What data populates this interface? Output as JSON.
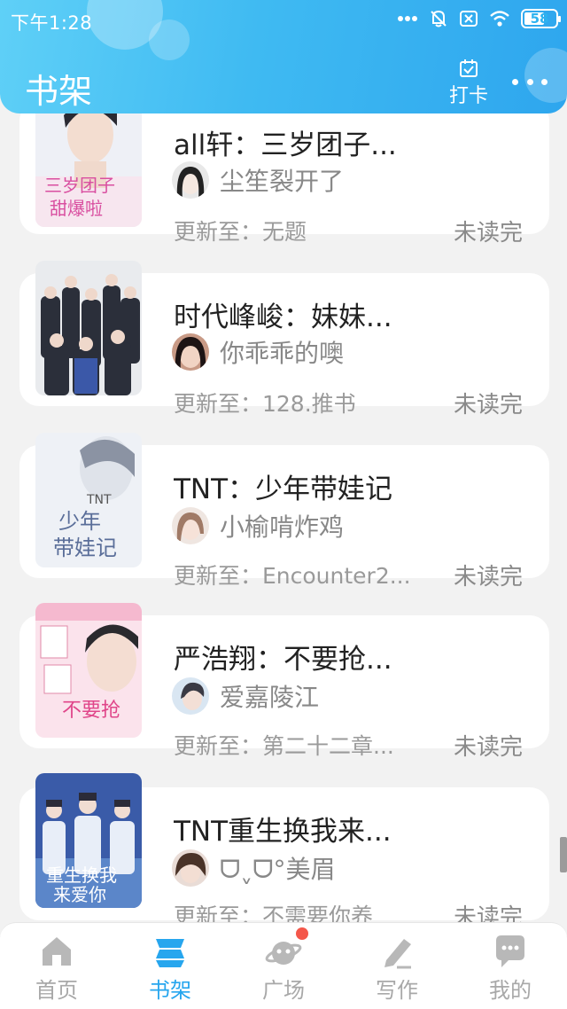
{
  "status_bar": {
    "time": "下午1:28",
    "battery": "58"
  },
  "header": {
    "title": "书架",
    "checkin_label": "打卡"
  },
  "books": [
    {
      "title": "all轩：三岁团子...",
      "author": "尘笙裂开了",
      "update": "更新至：无题",
      "status": "未读完"
    },
    {
      "title": "时代峰峻：妹妹...",
      "author": "你乖乖的噢",
      "update": "更新至：128.推书",
      "status": "未读完"
    },
    {
      "title": "TNT：少年带娃记",
      "author": "小榆啃炸鸡",
      "update": "更新至：Encounter2...",
      "status": "未读完"
    },
    {
      "title": "严浩翔：不要抢...",
      "author": "爱嘉陵江",
      "update": "更新至：第二十二章...",
      "status": "未读完"
    },
    {
      "title": "TNT重生换我来...",
      "author": "ᗜˬᗜ°美眉",
      "update": "更新至：不需要你养",
      "status": "未读完"
    }
  ],
  "bottom_nav": [
    {
      "label": "首页",
      "icon": "home-icon",
      "active": false
    },
    {
      "label": "书架",
      "icon": "bookshelf-icon",
      "active": true
    },
    {
      "label": "广场",
      "icon": "planet-icon",
      "active": false
    },
    {
      "label": "写作",
      "icon": "pen-icon",
      "active": false
    },
    {
      "label": "我的",
      "icon": "chat-bubble-icon",
      "active": false
    }
  ],
  "colors": {
    "accent": "#27a6ee",
    "header_start": "#5fd0f7",
    "header_end": "#2ea6ee",
    "badge": "#f4574a"
  }
}
